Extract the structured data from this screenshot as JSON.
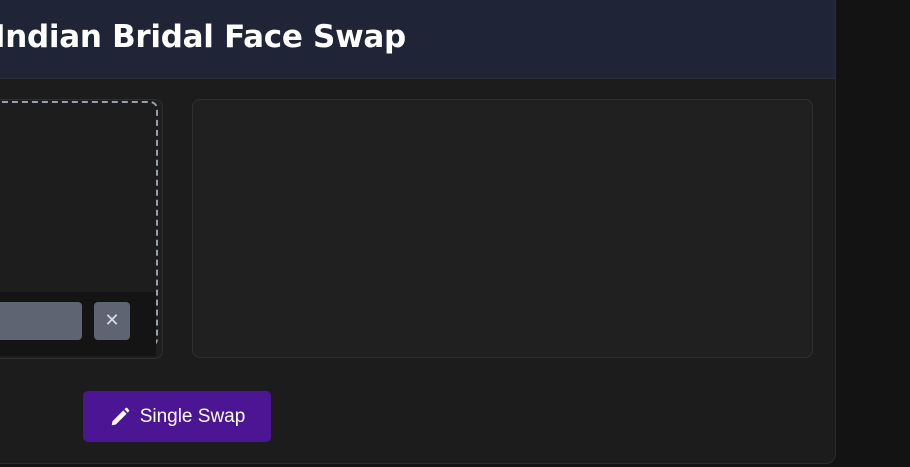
{
  "header": {
    "title": "Indian Bridal Face Swap"
  },
  "upload": {
    "remove_label": "✕"
  },
  "actions": {
    "swap_label": "Single Swap",
    "swap_icon": "pencil-icon"
  },
  "colors": {
    "header_bg": "#1f2536",
    "panel_bg": "#1c1c1c",
    "button_accent": "#4c1594",
    "file_chip": "#5f6472"
  }
}
